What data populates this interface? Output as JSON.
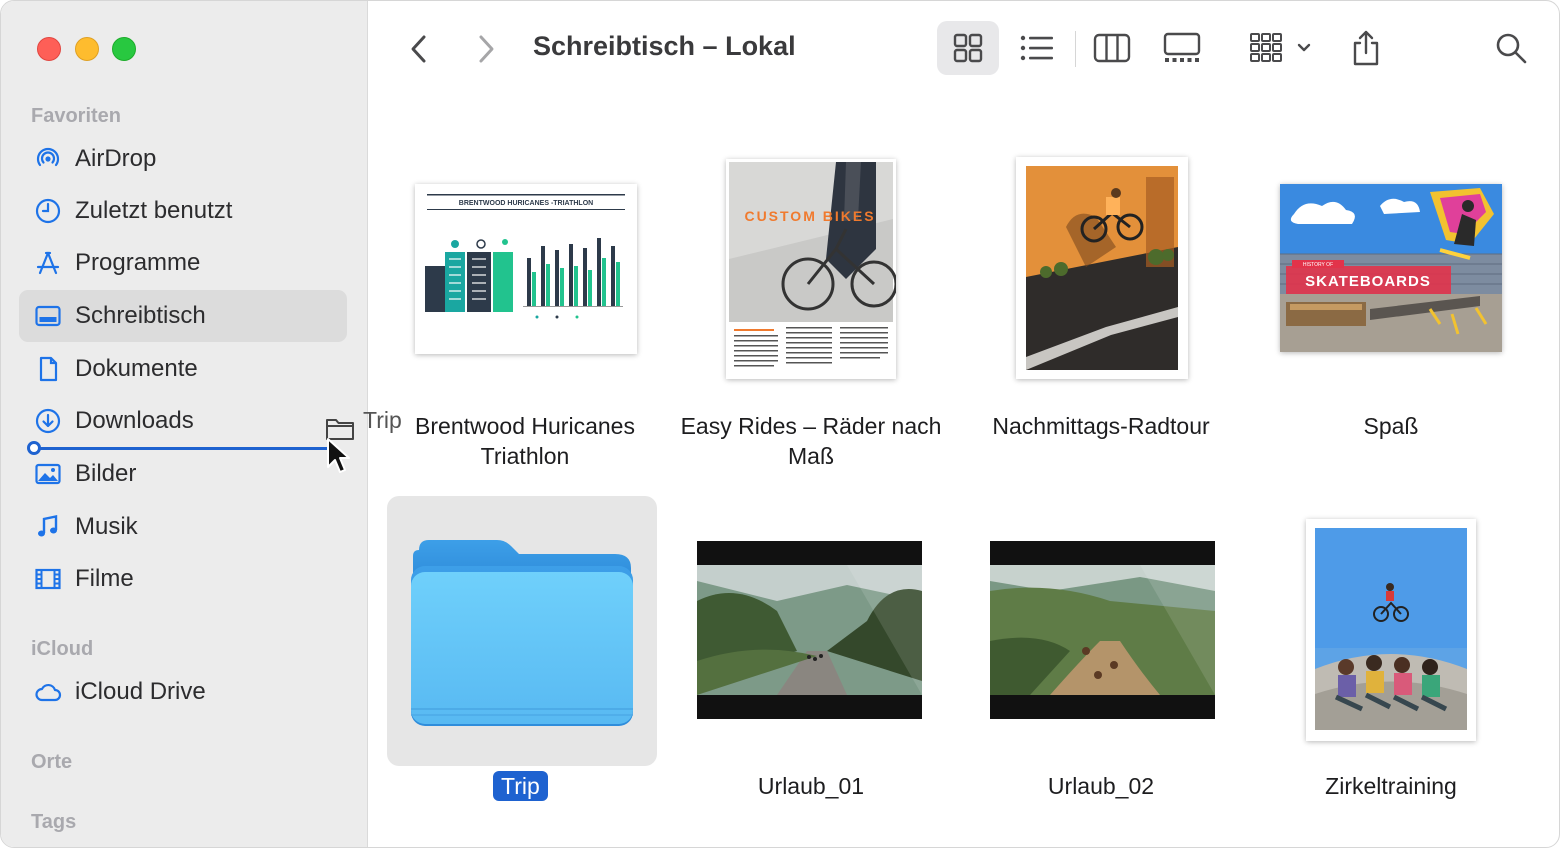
{
  "window": {
    "title": "Schreibtisch – Lokal"
  },
  "sidebar": {
    "favorites_title": "Favoriten",
    "icloud_title": "iCloud",
    "places_title": "Orte",
    "tags_title": "Tags",
    "favorites": [
      {
        "label": "AirDrop",
        "icon": "airdrop-icon"
      },
      {
        "label": "Zuletzt benutzt",
        "icon": "clock-icon"
      },
      {
        "label": "Programme",
        "icon": "applications-icon"
      },
      {
        "label": "Schreibtisch",
        "icon": "desktop-icon",
        "selected": true
      },
      {
        "label": "Dokumente",
        "icon": "document-icon"
      },
      {
        "label": "Downloads",
        "icon": "download-icon"
      },
      {
        "label": "Bilder",
        "icon": "photo-icon"
      },
      {
        "label": "Musik",
        "icon": "music-icon"
      },
      {
        "label": "Filme",
        "icon": "film-icon"
      }
    ],
    "icloud": [
      {
        "label": "iCloud Drive",
        "icon": "cloud-icon"
      }
    ],
    "drag": {
      "label": "Trip"
    }
  },
  "toolbar": {
    "back": "chevron-left-icon",
    "forward": "chevron-right-icon",
    "views": [
      "icon-view-icon",
      "list-view-icon",
      "column-view-icon",
      "gallery-view-icon"
    ],
    "group": "group-icon",
    "share": "share-icon",
    "search": "search-icon"
  },
  "files": [
    {
      "name_line1": "Brentwood Huricanes",
      "name_line2": "Triathlon",
      "kind": "document"
    },
    {
      "name_line1": "Easy Rides – Räder nach",
      "name_line2": "Maß",
      "kind": "document"
    },
    {
      "name_line1": "Nachmittags-Radtour",
      "name_line2": "",
      "kind": "image"
    },
    {
      "name_line1": "Spaß",
      "name_line2": "",
      "kind": "image"
    },
    {
      "name_line1": "Trip",
      "name_line2": "",
      "kind": "folder",
      "selected": true
    },
    {
      "name_line1": "Urlaub_01",
      "name_line2": "",
      "kind": "video"
    },
    {
      "name_line1": "Urlaub_02",
      "name_line2": "",
      "kind": "video"
    },
    {
      "name_line1": "Zirkeltraining",
      "name_line2": "",
      "kind": "image"
    }
  ],
  "thumb_text": {
    "triathlon_title": "BRENTWOOD HURICANES -TRIATHLON",
    "custom_bikes": "CUSTOM BIKES",
    "skateboards": "SKATEBOARDS",
    "history": "HISTORY OF"
  },
  "colors": {
    "accent": "#1e62d0",
    "sidebar_bg": "#ececec",
    "selection_bg": "#e6e6e6",
    "folder": "#5ec2f7",
    "teal": "#1aa7a1",
    "green": "#22c38e",
    "red_light": "#fe5f57",
    "yellow_light": "#febc2e",
    "green_light": "#28c840"
  }
}
